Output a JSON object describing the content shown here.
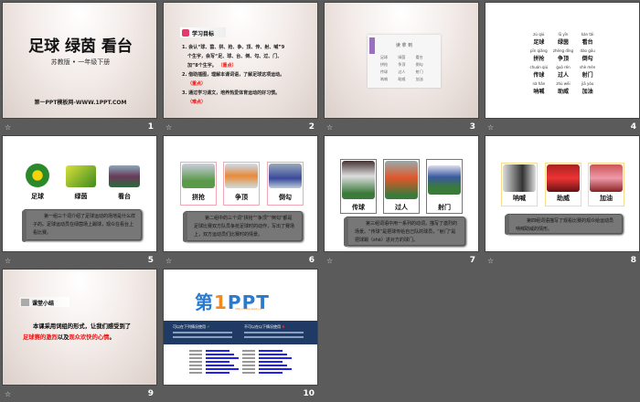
{
  "slides": [
    {
      "number": "1",
      "title": "足球 绿茵 看台",
      "subtitle": "苏教版 • 一年级下册",
      "footer": "第一PPT模板网-WWW.1PPT.COM"
    },
    {
      "number": "2",
      "header": "学习目标",
      "lines": [
        "1. 会认“球、茵、拼、抢、争、顶、传、射、喊”9",
        "个生字，会写“足、球、台、倒、勾、过、门、",
        "加”8个生字。",
        "（重点）",
        "2. 借助插图，理解本课词语，了解足球这项运动。",
        "（重点）",
        "3. 通过学习课文，培养热爱体育运动的好习惯。",
        "（难点）"
      ]
    },
    {
      "number": "3",
      "card_title": "读 拿 到",
      "words": [
        "足球",
        "绿茵",
        "看台",
        "拼抢",
        "争顶",
        "倒勾",
        "传球",
        "过人",
        "射门",
        "呐喊",
        "助威",
        "加油"
      ]
    },
    {
      "number": "4",
      "rows": [
        [
          {
            "py": "zú qiú",
            "hz": "足球"
          },
          {
            "py": "lǜ yīn",
            "hz": "绿茵"
          },
          {
            "py": "kàn tái",
            "hz": "看台"
          }
        ],
        [
          {
            "py": "pīn qiǎng",
            "hz": "拼抢"
          },
          {
            "py": "zhēng dǐng",
            "hz": "争顶"
          },
          {
            "py": "dào gōu",
            "hz": "倒勾"
          }
        ],
        [
          {
            "py": "chuán qiú",
            "hz": "传球"
          },
          {
            "py": "guò rén",
            "hz": "过人"
          },
          {
            "py": "shè mén",
            "hz": "射门"
          }
        ],
        [
          {
            "py": "nà hǎn",
            "hz": "呐喊"
          },
          {
            "py": "zhù wēi",
            "hz": "助威"
          },
          {
            "py": "jiā yóu",
            "hz": "加油"
          }
        ]
      ]
    },
    {
      "number": "5",
      "labels": [
        "足球",
        "绿茵",
        "看台"
      ],
      "text": "第一组三个词介绍了足球运动的场地是什么样子的。足球运动员在绿茵场上踢球，观众在看台上看比赛。"
    },
    {
      "number": "6",
      "labels": [
        "拼抢",
        "争顶",
        "倒勾"
      ],
      "text": "第二组中的三个词“拼抢”“争顶”“倒勾”都是足球比赛双方队员争抢足球时的动作，写出了赛场上，双方运动员们比赛时的情景。"
    },
    {
      "number": "7",
      "labels": [
        "传球",
        "过人",
        "射门"
      ],
      "text": "第三组词语中用一系列的动词，描写了激烈的场景。“传球”是把球传给自己队的球员，“射门”是把球踢（shè）进对方的球门。"
    },
    {
      "number": "8",
      "labels": [
        "呐喊",
        "助威",
        "加油"
      ],
      "text": "第四组词语描写了观看比赛的观众给运动员呐喊助威的情形。"
    },
    {
      "number": "9",
      "header": "课堂小结",
      "line1": "本课采用词组的形式，让我们感受到了",
      "red1": "足球赛的激烈",
      "mid": "以及",
      "red2": "观众欢快的心情",
      "end": "。"
    },
    {
      "number": "10",
      "logo_a": "第",
      "logo_b": "1",
      "logo_c": "PPT",
      "url": "http://www.1ppt.com",
      "can_use": "可以在下列情况使用",
      "cannot_use": "不可以在以下情况使用"
    }
  ],
  "colors": {
    "background": "#5b5b5b",
    "accent_red": "#e11111",
    "navy": "#1f3a64",
    "logo_blue": "#2a7bd0",
    "logo_orange": "#f08a1c"
  }
}
